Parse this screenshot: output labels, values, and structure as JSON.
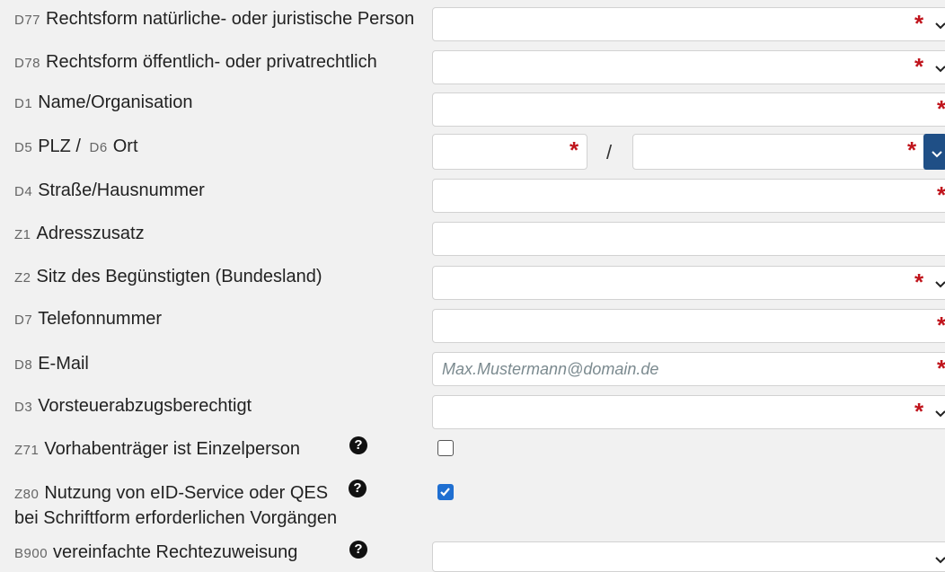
{
  "fields": [
    {
      "code": "D77",
      "label": "Rechtsform natürliche- oder juristische Person"
    },
    {
      "code": "D78",
      "label": "Rechtsform öffentlich- oder privatrechtlich"
    },
    {
      "code": "D1",
      "label": "Name/Organisation"
    },
    {
      "code": "D5",
      "label": "PLZ /",
      "code2": "D6",
      "label2": "Ort"
    },
    {
      "code": "D4",
      "label": "Straße/Hausnummer"
    },
    {
      "code": "Z1",
      "label": "Adresszusatz"
    },
    {
      "code": "Z2",
      "label": "Sitz des Begünstigten (Bundesland)"
    },
    {
      "code": "D7",
      "label": "Telefonnummer"
    },
    {
      "code": "D8",
      "label": "E-Mail",
      "placeholder": "Max.Mustermann@domain.de"
    },
    {
      "code": "D3",
      "label": "Vorsteuerabzugsberechtigt"
    },
    {
      "code": "Z71",
      "label": "Vorhabenträger ist Einzelperson",
      "checked": false
    },
    {
      "code": "Z80",
      "label": "Nutzung von eID-Service oder QES",
      "label_line2": "bei Schriftform erforderlichen Vorgängen",
      "checked": true
    },
    {
      "code": "B900",
      "label": "vereinfachte Rechtezuweisung"
    }
  ],
  "symbols": {
    "required": "*",
    "separator": "/",
    "help": "?"
  },
  "colors": {
    "required": "#c0141c",
    "accent": "#1f4f86",
    "checkbox": "#1f6fd1"
  }
}
